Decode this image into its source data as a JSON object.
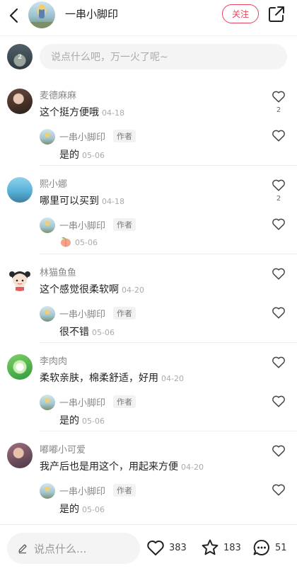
{
  "header": {
    "author_name": "一串小脚印",
    "follow_label": "关注",
    "icons": {
      "back": "back-icon",
      "share": "share-icon"
    }
  },
  "top_input": {
    "placeholder": "说点什么吧，万一火了呢~"
  },
  "comments": [
    {
      "user": "麦德麻麻",
      "text": "这个挺方便哦",
      "date": "04-18",
      "likes": "2",
      "reply": {
        "user": "一串小脚印",
        "tag": "作者",
        "text": "是的",
        "date": "05-06"
      }
    },
    {
      "user": "熙小娜",
      "text": "哪里可以买到",
      "date": "04-18",
      "likes": "2",
      "reply": {
        "user": "一串小脚印",
        "tag": "作者",
        "text": "",
        "emoji": "peach-emoji",
        "date": "05-06"
      }
    },
    {
      "user": "林猫鱼鱼",
      "text": "这个感觉很柔软啊",
      "date": "04-20",
      "likes": "",
      "reply": {
        "user": "一串小脚印",
        "tag": "作者",
        "text": "很不错",
        "date": "05-06"
      }
    },
    {
      "user": "李肉肉",
      "text": "柔软亲肤，棉柔舒适，好用",
      "date": "04-20",
      "likes": "",
      "reply": {
        "user": "一串小脚印",
        "tag": "作者",
        "text": "是的",
        "date": "05-06"
      }
    },
    {
      "user": "嘟嘟小可爱",
      "text": "我产后也是用这个，用起来方便",
      "date": "04-20",
      "likes": "",
      "reply": {
        "user": "一串小脚印",
        "tag": "作者",
        "text": "是的",
        "date": "05-06"
      }
    }
  ],
  "bottom_bar": {
    "input_placeholder": "说点什么...",
    "like_count": "383",
    "collect_count": "183",
    "comment_count": "51"
  },
  "colors": {
    "accent": "#e7425c",
    "text": "#222222",
    "muted": "#888888"
  }
}
